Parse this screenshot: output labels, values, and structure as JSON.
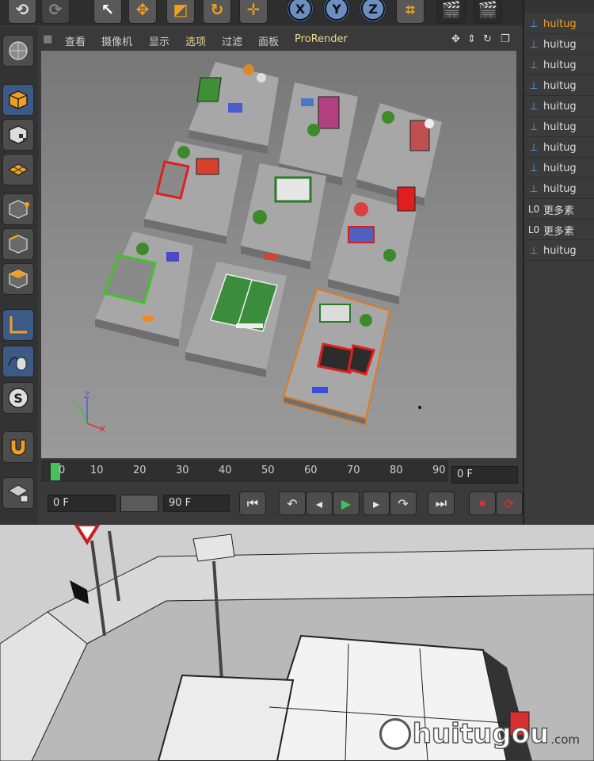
{
  "viewport_menu": [
    {
      "label": "查看"
    },
    {
      "label": "摄像机"
    },
    {
      "label": "显示"
    },
    {
      "label": "选项"
    },
    {
      "label": "过滤"
    },
    {
      "label": "面板"
    },
    {
      "label": "ProRender"
    }
  ],
  "toolbar": {
    "axis_x": "X",
    "axis_y": "Y",
    "axis_z": "Z"
  },
  "object_manager": {
    "items": [
      {
        "label": "huitug",
        "icon": "null-object-icon"
      },
      {
        "label": "huitug",
        "icon": "null-object-icon"
      },
      {
        "label": "huitug",
        "icon": "null-object-icon"
      },
      {
        "label": "huitug",
        "icon": "null-object-icon"
      },
      {
        "label": "huitug",
        "icon": "null-object-icon"
      },
      {
        "label": "huitug",
        "icon": "null-object-icon"
      },
      {
        "label": "huitug",
        "icon": "null-object-icon"
      },
      {
        "label": "huitug",
        "icon": "null-object-icon"
      },
      {
        "label": "huitug",
        "icon": "null-object-icon"
      },
      {
        "label": "更多素",
        "icon": "layer-zero-icon"
      },
      {
        "label": "更多素",
        "icon": "layer-zero-icon"
      },
      {
        "label": "huitug",
        "icon": "null-object-icon"
      }
    ]
  },
  "timeline": {
    "ticks": [
      "0",
      "10",
      "20",
      "30",
      "40",
      "50",
      "60",
      "70",
      "80",
      "90"
    ],
    "current_frame": "0 F",
    "start_frame": "0 F",
    "end_frame": "90 F"
  },
  "axis_gizmo": {
    "x": "X",
    "y": "Y",
    "z": "Z"
  },
  "watermark": {
    "text": "huitugou",
    "domain": ".com"
  },
  "colors": {
    "accent": "#f0a020",
    "active_tool": "#3d5a86",
    "play_green": "#46c05a",
    "record_red": "#d83030"
  }
}
